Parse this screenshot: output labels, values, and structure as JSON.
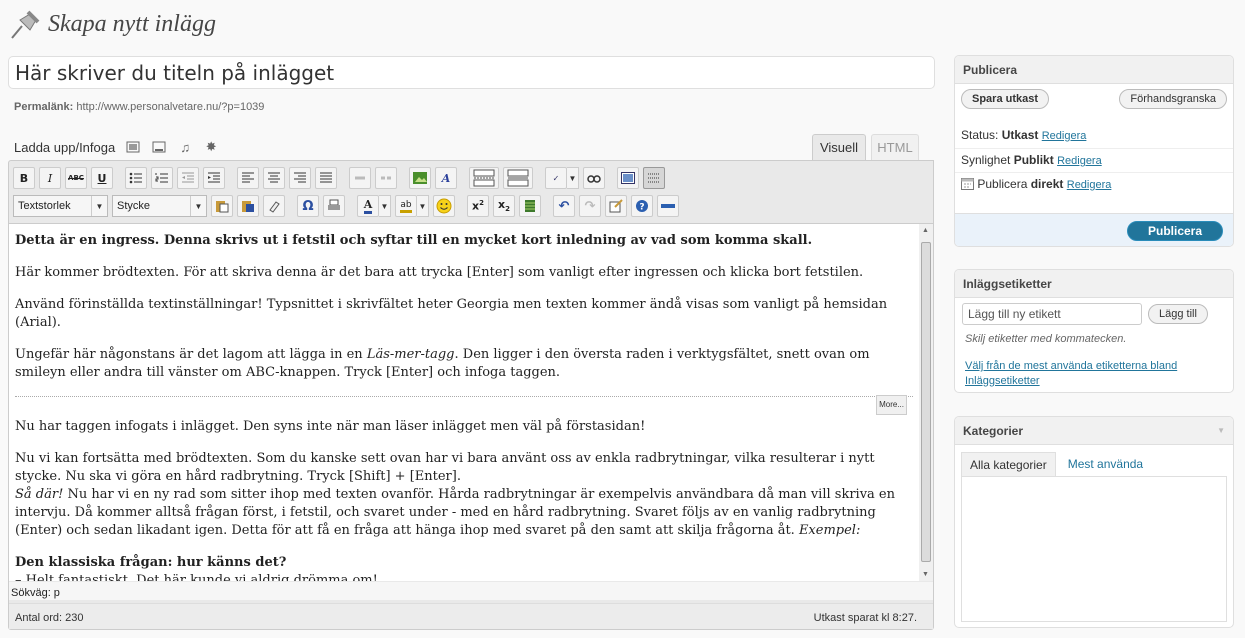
{
  "header": {
    "title": "Skapa nytt inlägg"
  },
  "post": {
    "title": "Här skriver du titeln på inlägget",
    "permalink_label": "Permalänk:",
    "permalink_url": "http://www.personalvetare.nu/?p=1039"
  },
  "media": {
    "label": "Ladda upp/Infoga"
  },
  "editor_tabs": {
    "visual": "Visuell",
    "html": "HTML"
  },
  "toolbar": {
    "font_size_select": "Textstorlek",
    "format_select": "Stycke",
    "icons": [
      "bold-icon",
      "italic-icon",
      "strikethrough-icon",
      "underline-icon",
      "bullet-list-icon",
      "numbered-list-icon",
      "outdent-icon",
      "indent-icon",
      "align-left-icon",
      "align-center-icon",
      "align-right-icon",
      "align-justify-icon",
      "link-icon",
      "unlink-icon",
      "image-icon",
      "media-icon",
      "insert-more-icon",
      "page-break-icon",
      "spellcheck-icon",
      "search-icon",
      "fullscreen-icon",
      "kitchen-sink-icon",
      "paste-text-icon",
      "paste-word-icon",
      "remove-format-icon",
      "special-char-icon",
      "print-icon",
      "text-color-icon",
      "highlight-icon",
      "smiley-icon",
      "superscript-icon",
      "subscript-icon",
      "media-file-icon",
      "undo-icon",
      "redo-icon",
      "edit-image-icon",
      "help-icon",
      "hr-icon"
    ]
  },
  "content": {
    "p1": "Detta är en ingress. Denna skrivs ut i fetstil och syftar till en mycket kort inledning av vad som komma skall.",
    "p2": "Här kommer brödtexten. För att skriva denna är det bara att trycka [Enter] som vanligt efter ingressen och klicka bort fetstilen.",
    "p3": "Använd förinställda textinställningar! Typsnittet i skrivfältet heter Georgia men texten kommer ändå visas som vanligt på hemsidan (Arial).",
    "p4_a": "Ungefär här någonstans är det lagom att lägga in en ",
    "p4_em": "Läs-mer-tagg",
    "p4_b": ". Den ligger i den översta raden i verktygsfältet, snett ovan om smileyn eller andra till vänster om ABC-knappen. Tryck [Enter] och infoga taggen.",
    "more_label": "More...",
    "p5": "Nu har taggen infogats i inlägget. Den syns inte när man läser inlägget men väl på förstasidan!",
    "p6_a": "Nu vi kan fortsätta med brödtexten. Som du kanske sett ovan har vi bara använt oss av enkla radbrytningar, vilka resulterar i nytt stycke. Nu ska vi göra en hård radbrytning. Tryck [Shift] + [Enter].",
    "p6_em": "Så där!",
    "p6_b": " Nu har vi en ny rad som sitter ihop med texten ovanför. Hårda radbrytningar är exempelvis användbara då man vill skriva en intervju. Då kommer alltså frågan först, i fetstil, och svaret under - med en hård radbrytning. Svaret följs av en vanlig radbrytning (Enter) och sedan likadant igen. Detta för att få en fråga att hänga ihop med svaret på den samt att skilja frågorna åt. ",
    "p6_em2": "Exempel:",
    "p7_q": "Den klassiska frågan: hur känns det?",
    "p7_a": "– Helt fantastiskt. Det här kunde vi aldrig drömma om!"
  },
  "pathbar": {
    "text": "Sökväg: p"
  },
  "statusbar": {
    "word_count": "Antal ord: 230",
    "saved": "Utkast sparat kl 8:27."
  },
  "publish": {
    "title": "Publicera",
    "save_draft": "Spara utkast",
    "preview": "Förhandsgranska",
    "status_label": "Status:",
    "status_value": "Utkast",
    "visibility_label": "Synlighet",
    "visibility_value": "Publikt",
    "publish_label": "Publicera",
    "publish_value": "direkt",
    "edit": "Redigera",
    "publish_button": "Publicera"
  },
  "tags": {
    "title": "Inläggsetiketter",
    "placeholder": "Lägg till ny etikett",
    "add": "Lägg till",
    "hint": "Skilj etiketter med kommatecken.",
    "choose_link": "Välj från de mest använda etiketterna bland Inläggsetiketter"
  },
  "categories": {
    "title": "Kategorier",
    "tab_all": "Alla kategorier",
    "tab_popular": "Mest använda"
  },
  "colors": {
    "link": "#21759b",
    "publish": "#21759b",
    "accent_bg": "#eaf2fa"
  }
}
